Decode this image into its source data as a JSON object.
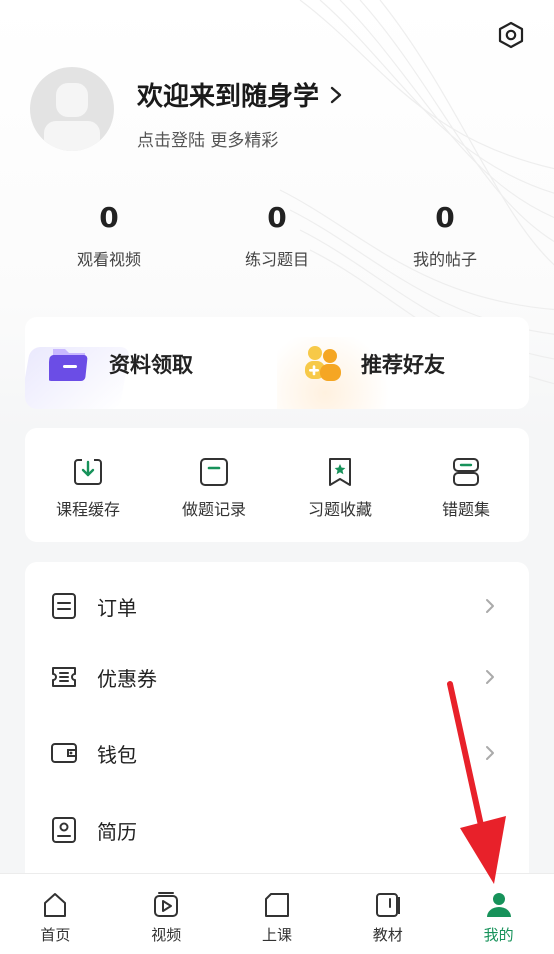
{
  "header": {
    "welcome_title": "欢迎来到随身学",
    "subtitle": "点击登陆 更多精彩"
  },
  "stats": [
    {
      "value": "0",
      "label": "观看视频"
    },
    {
      "value": "0",
      "label": "练习题目"
    },
    {
      "value": "0",
      "label": "我的帖子"
    }
  ],
  "promo": {
    "material_label": "资料领取",
    "friends_label": "推荐好友"
  },
  "quick_actions": [
    {
      "label": "课程缓存",
      "icon": "download-icon"
    },
    {
      "label": "做题记录",
      "icon": "record-icon"
    },
    {
      "label": "习题收藏",
      "icon": "bookmark-star-icon"
    },
    {
      "label": "错题集",
      "icon": "wrong-set-icon"
    }
  ],
  "menu": [
    {
      "label": "订单",
      "icon": "order-icon"
    },
    {
      "label": "优惠券",
      "icon": "coupon-icon"
    },
    {
      "label": "钱包",
      "icon": "wallet-icon"
    },
    {
      "label": "简历",
      "icon": "resume-icon"
    }
  ],
  "tabs": [
    {
      "label": "首页",
      "icon": "home-icon"
    },
    {
      "label": "视频",
      "icon": "video-icon"
    },
    {
      "label": "上课",
      "icon": "class-icon"
    },
    {
      "label": "教材",
      "icon": "book-icon"
    },
    {
      "label": "我的",
      "icon": "profile-icon",
      "active": true
    }
  ],
  "colors": {
    "accent_green": "#17925a",
    "annotation_red": "#e8212a",
    "material_purple": "#6b4de6",
    "friends_orange": "#f5a623"
  }
}
